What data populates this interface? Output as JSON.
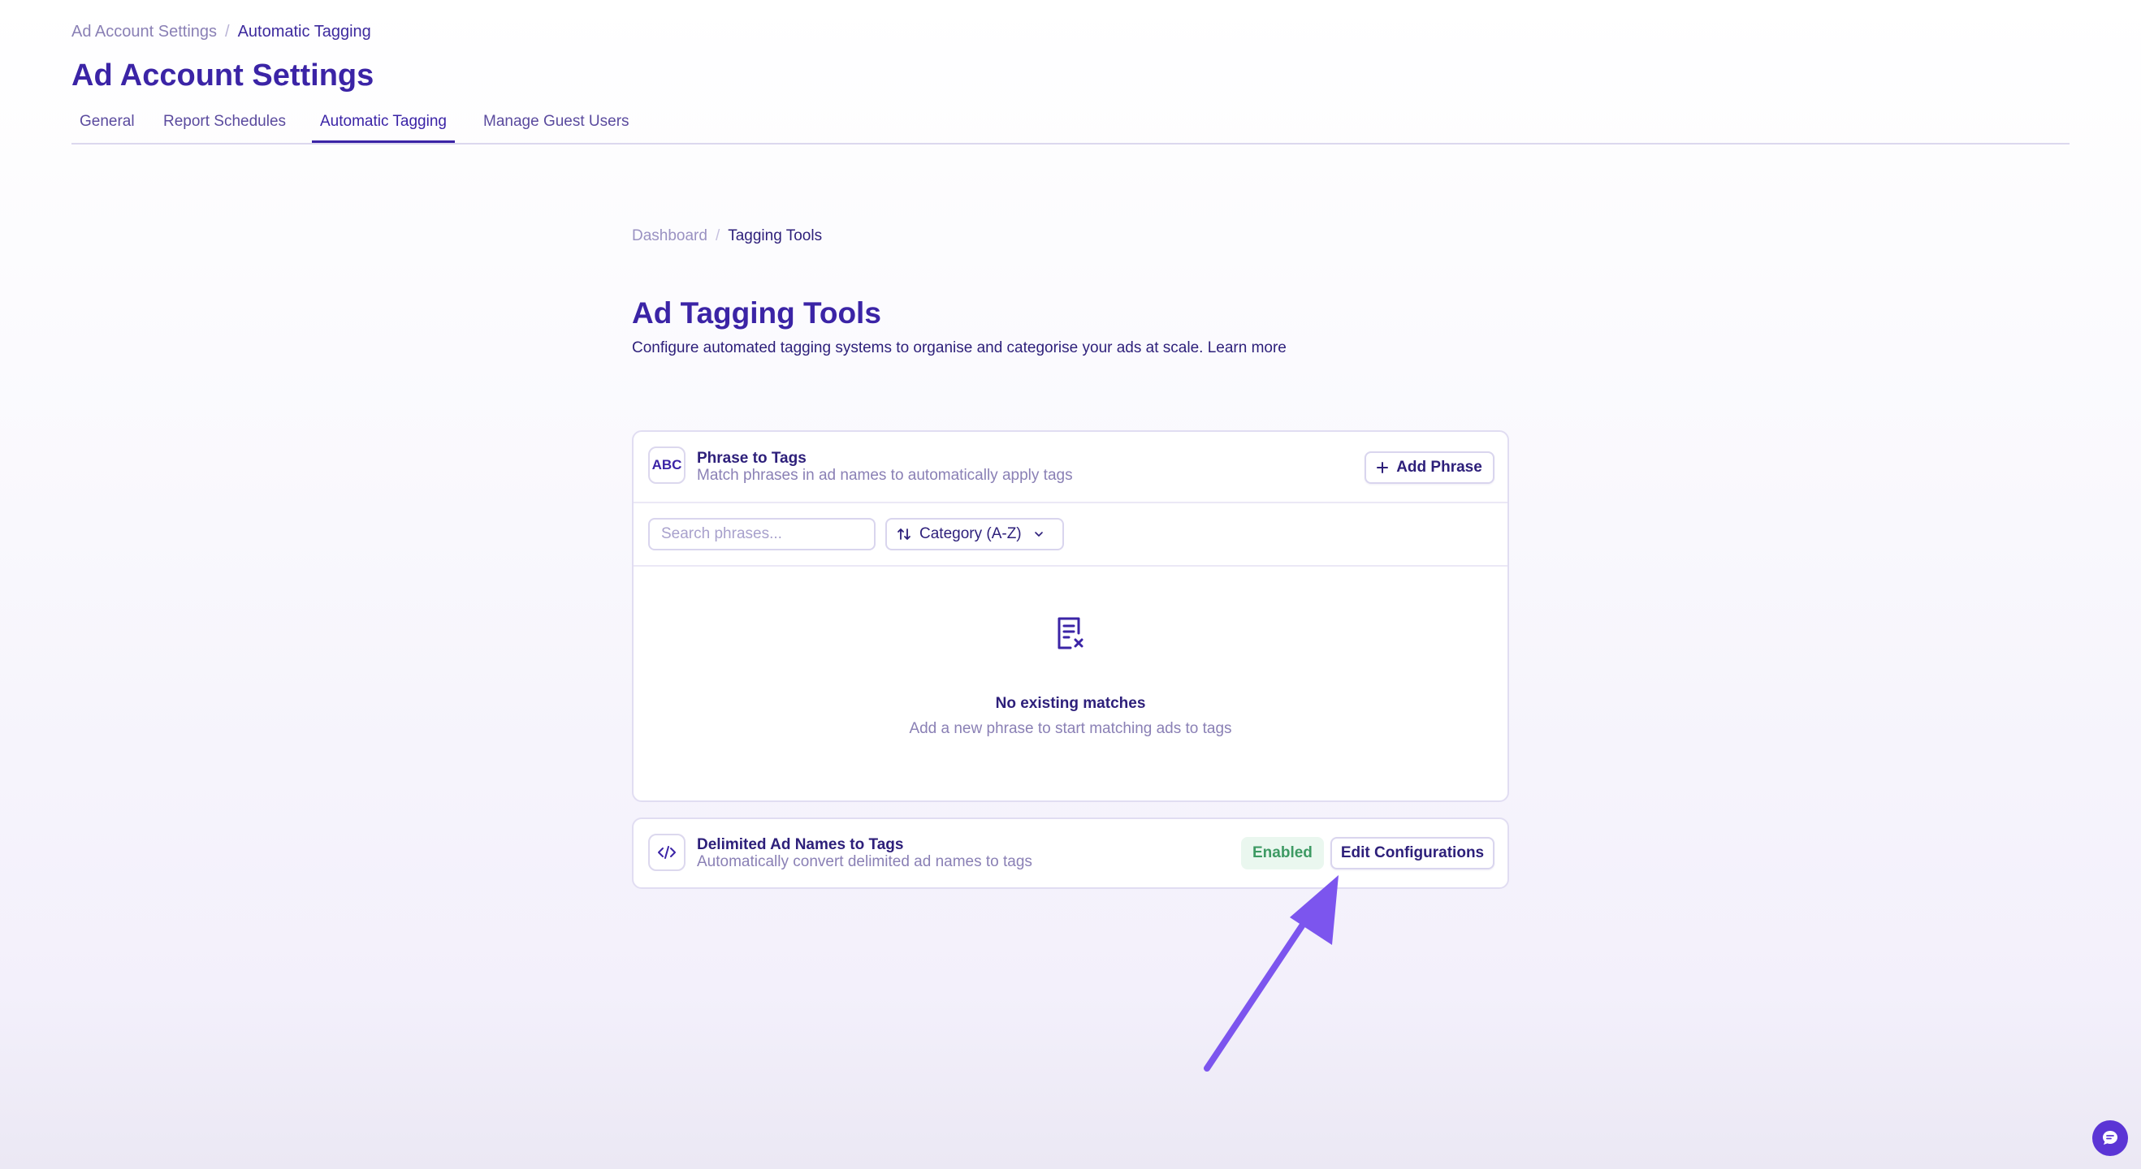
{
  "top_breadcrumb": {
    "parent": "Ad Account Settings",
    "separator": "/",
    "current": "Automatic Tagging"
  },
  "page_title": "Ad Account Settings",
  "tabs": [
    {
      "label": "General",
      "active": false
    },
    {
      "label": "Report Schedules",
      "active": false
    },
    {
      "label": "Automatic Tagging",
      "active": true
    },
    {
      "label": "Manage Guest Users",
      "active": false
    }
  ],
  "inner_breadcrumb": {
    "parent": "Dashboard",
    "separator": "/",
    "current": "Tagging Tools"
  },
  "section": {
    "title": "Ad Tagging Tools",
    "description": "Configure automated tagging systems to organise and categorise your ads at scale.",
    "learn_more": "Learn more"
  },
  "phrase_card": {
    "icon_text": "ABC",
    "title": "Phrase to Tags",
    "subtitle": "Match phrases in ad names to automatically apply tags",
    "add_button": "Add Phrase",
    "search_placeholder": "Search phrases...",
    "sort_label": "Category (A-Z)",
    "empty_title": "No existing matches",
    "empty_subtitle": "Add a new phrase to start matching ads to tags"
  },
  "delimited_card": {
    "title": "Delimited Ad Names to Tags",
    "subtitle": "Automatically convert delimited ad names to tags",
    "status": "Enabled",
    "edit_button": "Edit Configurations"
  },
  "colors": {
    "primary": "#3b24a6",
    "text": "#2d1f7a",
    "muted": "#8a80b5",
    "enabled_bg": "#eaf7ef",
    "enabled_text": "#3d9a63",
    "annotation_arrow": "#7c55ee",
    "chat_bubble": "#5b35d5"
  },
  "icons": {
    "add": "plus-icon",
    "sort": "sort-arrows-icon",
    "dropdown": "chevron-down-icon",
    "empty": "document-x-icon",
    "code": "code-icon",
    "chat": "chat-bubble-icon",
    "annotation": "annotation-arrow-icon"
  }
}
